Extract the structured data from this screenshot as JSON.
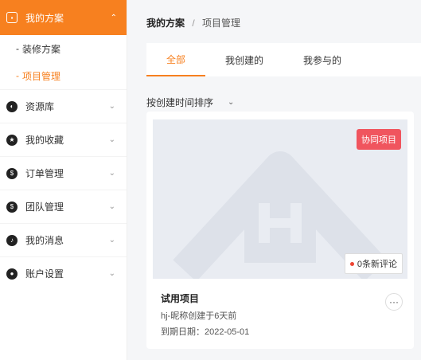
{
  "sidebar": {
    "header": {
      "label": "我的方案",
      "icon": "chat-square-icon"
    },
    "sub_items": [
      {
        "label": "装修方案",
        "dash": "-"
      },
      {
        "label": "项目管理",
        "dash": "-"
      }
    ],
    "items": [
      {
        "label": "资源库",
        "icon": "palette-icon",
        "glyph": "◐"
      },
      {
        "label": "我的收藏",
        "icon": "star-icon",
        "glyph": "★"
      },
      {
        "label": "订单管理",
        "icon": "dollar-icon",
        "glyph": "$"
      },
      {
        "label": "团队管理",
        "icon": "dollar-icon",
        "glyph": "$"
      },
      {
        "label": "我的消息",
        "icon": "bell-icon",
        "glyph": "♪"
      },
      {
        "label": "账户设置",
        "icon": "user-icon",
        "glyph": "●"
      }
    ],
    "active_color": "#f7801f"
  },
  "breadcrumb": {
    "root": "我的方案",
    "sep": "/",
    "current": "项目管理"
  },
  "tabs": [
    {
      "label": "全部"
    },
    {
      "label": "我创建的"
    },
    {
      "label": "我参与的"
    }
  ],
  "sort": {
    "label": "按创建时间排序"
  },
  "project_card": {
    "badge": "协同项目",
    "comments": "0条新评论",
    "title": "试用项目",
    "creator": "hj-昵称创建于6天前",
    "due": "到期日期：2022-05-01",
    "more": "···"
  }
}
